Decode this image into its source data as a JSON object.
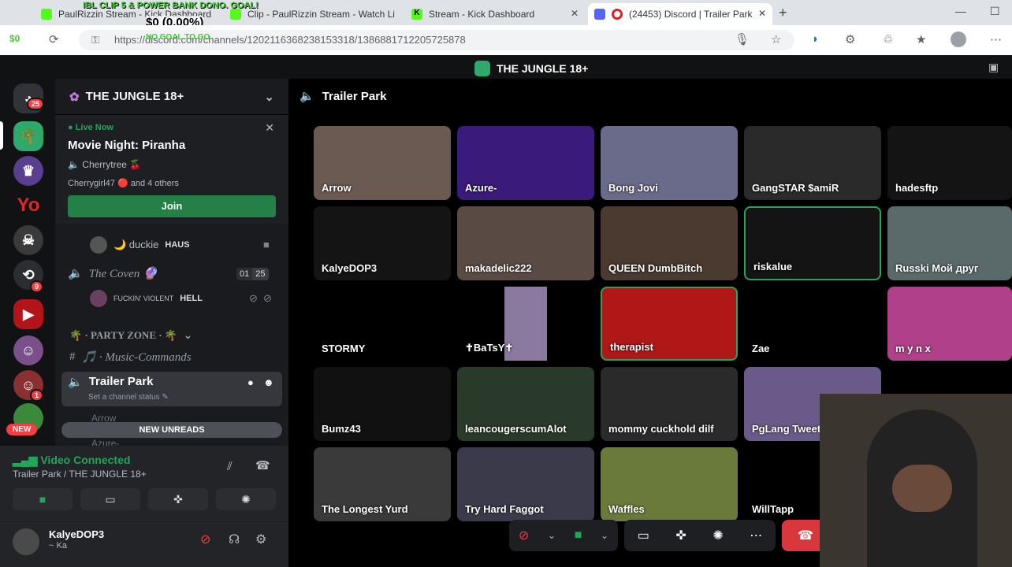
{
  "browser": {
    "tabs": [
      {
        "label": "PaulRizzin Stream - Kick Dashboard"
      },
      {
        "label": "Clip - PaulRizzin Stream - Watch Li"
      },
      {
        "label": "Stream - Kick Dashboard"
      },
      {
        "label": "(24453) Discord | Trailer Park"
      }
    ],
    "url": "https://discord.com/channels/1202116368238153318/1386881712205725878",
    "overlay_goal": "IBL CLIP 5 & POWER BANK DONO. GOAL!",
    "overlay_money": "$0 (0.00%)",
    "overlay_goal2": "NO GOAL TO GO",
    "overlay_tag": "$0"
  },
  "app": {
    "server_name": "THE JUNGLE 18+"
  },
  "rail": {
    "badges": [
      "25",
      "9",
      "1"
    ],
    "new_label": "NEW",
    "yo_text": "Yo"
  },
  "sidebar": {
    "server_name": "THE JUNGLE 18+",
    "live": {
      "status": "Live Now",
      "title": "Movie Night: Piranha",
      "host": "Cherrytree 🍒",
      "attendees": "Cherrygirl47 🔴 and 4 others",
      "join_label": "Join"
    },
    "channels": {
      "duckie_user": "🌙 duckie",
      "duckie_tag": "HAUS",
      "coven_name": "The Coven 🔮",
      "coven_count_a": "01",
      "coven_count_b": "25",
      "hell_user": "FUCKIN' VIOLENT",
      "hell_tag": "HELL",
      "party_zone": "🌴 · PARTY ZONE · 🌴",
      "music_commands": "🎵 · Music-Commands",
      "trailer_park": "Trailer Park",
      "status_hint": "Set a channel status",
      "arrow_user": "Arrow",
      "azure_user": "Azure-",
      "new_unreads": "NEW UNREADS"
    }
  },
  "voice_status": {
    "connected": "Video Connected",
    "location": "Trailer Park / THE JUNGLE 18+"
  },
  "user": {
    "name": "KalyeDOP3",
    "sub": "~ Ka"
  },
  "voice": {
    "channel": "Trailer Park",
    "tiles": [
      {
        "name": "Arrow"
      },
      {
        "name": "Azure-"
      },
      {
        "name": "Bong Jovi"
      },
      {
        "name": "GangSTAR $amiR"
      },
      {
        "name": "hadesftp"
      },
      {
        "name": "KalyeDOP3"
      },
      {
        "name": "makadelic222"
      },
      {
        "name": "QUEEN DumbBitch"
      },
      {
        "name": "riskalue"
      },
      {
        "name": "Russki Мой друг"
      },
      {
        "name": "STORMY"
      },
      {
        "name": "✝BaTsY✝"
      },
      {
        "name": "therapist"
      },
      {
        "name": "Zae"
      },
      {
        "name": "m y n x"
      },
      {
        "name": "Bumz43"
      },
      {
        "name": "leancougerscumAlot"
      },
      {
        "name": "mommy cuckhold dilf"
      },
      {
        "name": "PgLang Tweetx"
      },
      {
        "name": "The Longest Yurd"
      },
      {
        "name": "Try Hard Faggot"
      },
      {
        "name": "Waffles"
      },
      {
        "name": "WillTapp"
      }
    ]
  },
  "colors": {
    "accent_green": "#23a55a",
    "danger_red": "#da373c",
    "blurple": "#5865f2"
  }
}
